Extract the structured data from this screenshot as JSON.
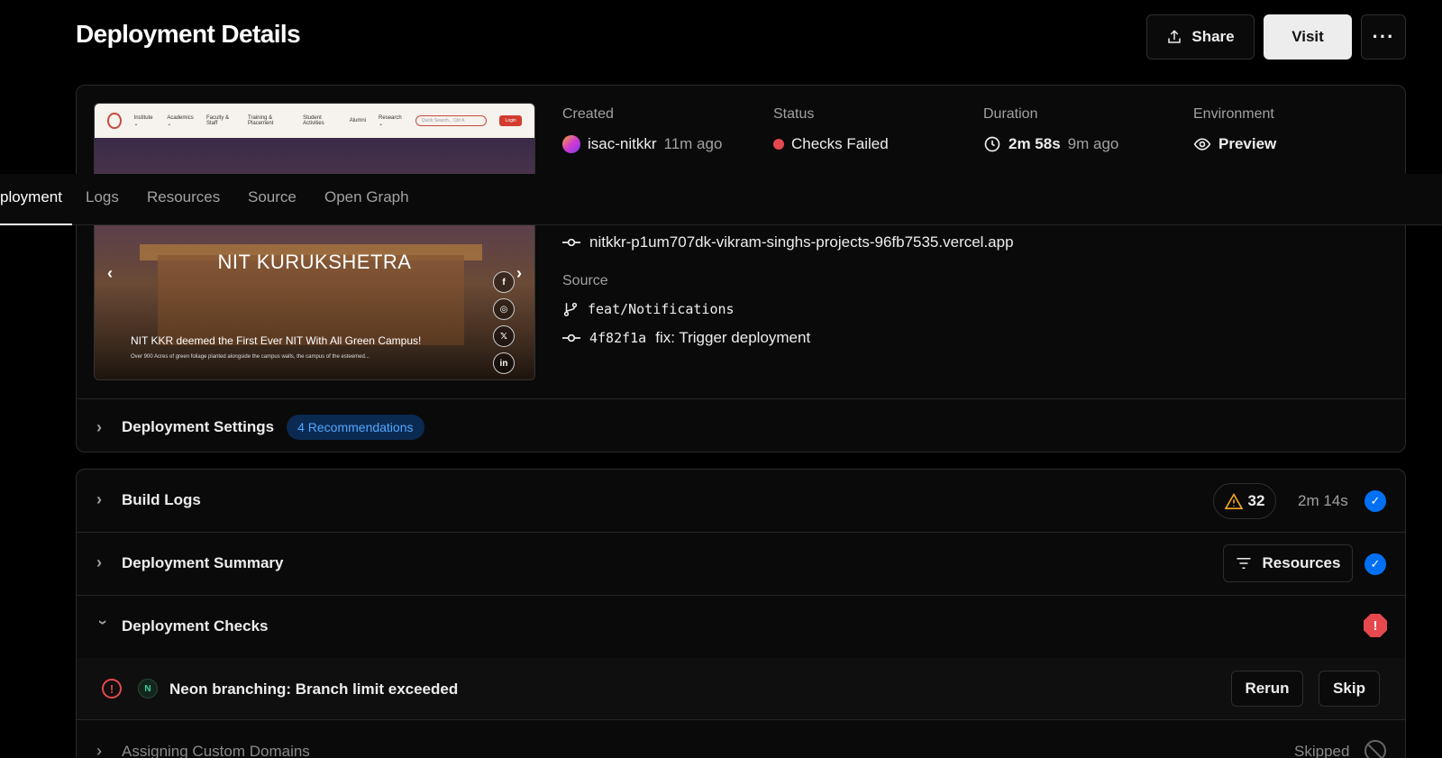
{
  "header": {
    "title": "Deployment Details",
    "share_label": "Share",
    "visit_label": "Visit",
    "more_label": "···"
  },
  "preview": {
    "nav_items": [
      "Institute ⌄",
      "Academics ⌄",
      "Faculty & Staff",
      "Training & Placement",
      "Student Activities",
      "Alumni",
      "Research ⌄"
    ],
    "search_placeholder": "Quick Search...  Ctrl K",
    "login_label": "Login",
    "hero_title": "NIT KURUKSHETRA",
    "caption": "NIT KKR deemed the First Ever NIT With All Green Campus!",
    "subcaption": "Over 900 Acres of green foliage planted alongside the campus walls, the campus of the esteemed...",
    "social": [
      "f",
      "◎",
      "𝕏",
      "in"
    ]
  },
  "meta": {
    "created_label": "Created",
    "created_user": "isac-nitkkr",
    "created_time": "11m ago",
    "status_label": "Status",
    "status_value": "Checks Failed",
    "status_color": "#e5484d",
    "duration_label": "Duration",
    "duration_value": "2m 58s",
    "duration_time": "9m ago",
    "environment_label": "Environment",
    "environment_value": "Preview"
  },
  "tabs": [
    "ployment",
    "Logs",
    "Resources",
    "Source",
    "Open Graph"
  ],
  "domain": "nitkkr-p1um707dk-vikram-singhs-projects-96fb7535.vercel.app",
  "source": {
    "label": "Source",
    "branch": "feat/Notifications",
    "commit_hash": "4f82f1a",
    "commit_message": "fix: Trigger deployment"
  },
  "settings": {
    "title": "Deployment Settings",
    "badge": "4 Recommendations"
  },
  "build_logs": {
    "title": "Build Logs",
    "warnings": "32",
    "duration": "2m 14s"
  },
  "summary": {
    "title": "Deployment Summary",
    "resources_label": "Resources"
  },
  "checks": {
    "title": "Deployment Checks",
    "item_title": "Neon branching: Branch limit exceeded",
    "rerun_label": "Rerun",
    "skip_label": "Skip",
    "next_title": "Assigning Custom Domains",
    "next_status": "Skipped"
  },
  "colors": {
    "accent_blue": "#0070f3",
    "error_red": "#e5484d",
    "warning": "#f5a623"
  }
}
